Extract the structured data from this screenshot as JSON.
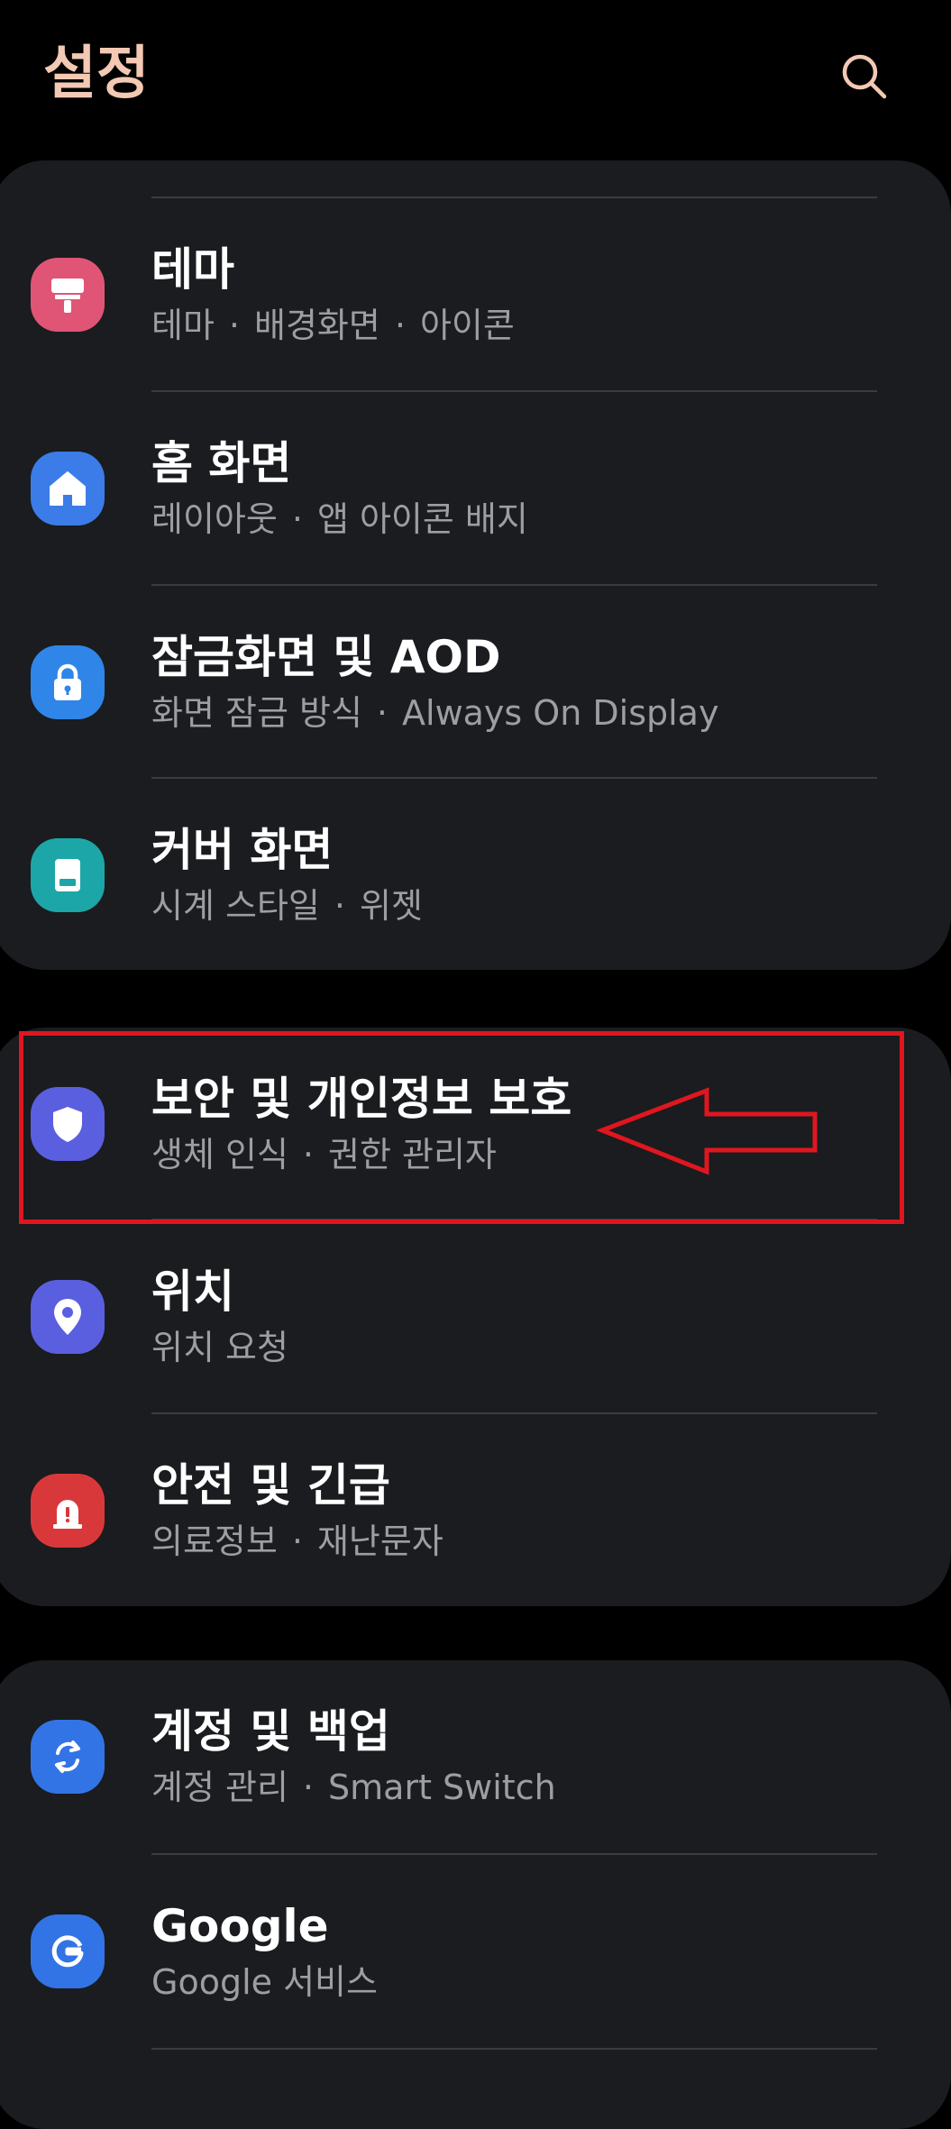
{
  "header": {
    "title": "설정",
    "search_icon": "search-icon"
  },
  "colors": {
    "title_color": "#f3c9b4",
    "card_bg": "#1a1c1f",
    "highlight": "#e0161f"
  },
  "groups": [
    {
      "items": [
        {
          "title": "테마",
          "subs": [
            "테마",
            "배경화면",
            "아이콘"
          ],
          "icon": "paint-roller-icon",
          "icon_color": "#e05575"
        },
        {
          "title": "홈 화면",
          "subs": [
            "레이아웃",
            "앱 아이콘 배지"
          ],
          "icon": "home-icon",
          "icon_color": "#3c7ce8"
        },
        {
          "title": "잠금화면 및 AOD",
          "subs": [
            "화면 잠금 방식",
            "Always On Display"
          ],
          "icon": "lock-icon",
          "icon_color": "#2f86e8"
        },
        {
          "title": "커버 화면",
          "subs": [
            "시계 스타일",
            "위젯"
          ],
          "icon": "cover-screen-icon",
          "icon_color": "#1da6a7"
        }
      ]
    },
    {
      "items": [
        {
          "title": "보안 및 개인정보 보호",
          "subs": [
            "생체 인식",
            "권한 관리자"
          ],
          "icon": "shield-icon",
          "icon_color": "#5a5fe0"
        },
        {
          "title": "위치",
          "subs": [
            "위치 요청"
          ],
          "icon": "location-pin-icon",
          "icon_color": "#5a5fe0"
        },
        {
          "title": "안전 및 긴급",
          "subs": [
            "의료정보",
            "재난문자"
          ],
          "icon": "emergency-alert-icon",
          "icon_color": "#d9383a"
        }
      ]
    },
    {
      "items": [
        {
          "title": "계정 및 백업",
          "subs": [
            "계정 관리",
            "Smart Switch"
          ],
          "icon": "sync-icon",
          "icon_color": "#3274e6"
        },
        {
          "title": "Google",
          "subs": [
            "Google 서비스"
          ],
          "icon": "google-icon",
          "icon_color": "#3274e6"
        }
      ]
    }
  ],
  "annotation": {
    "highlighted_item": "보안 및 개인정보 보호",
    "arrow": "left-arrow-annotation"
  }
}
